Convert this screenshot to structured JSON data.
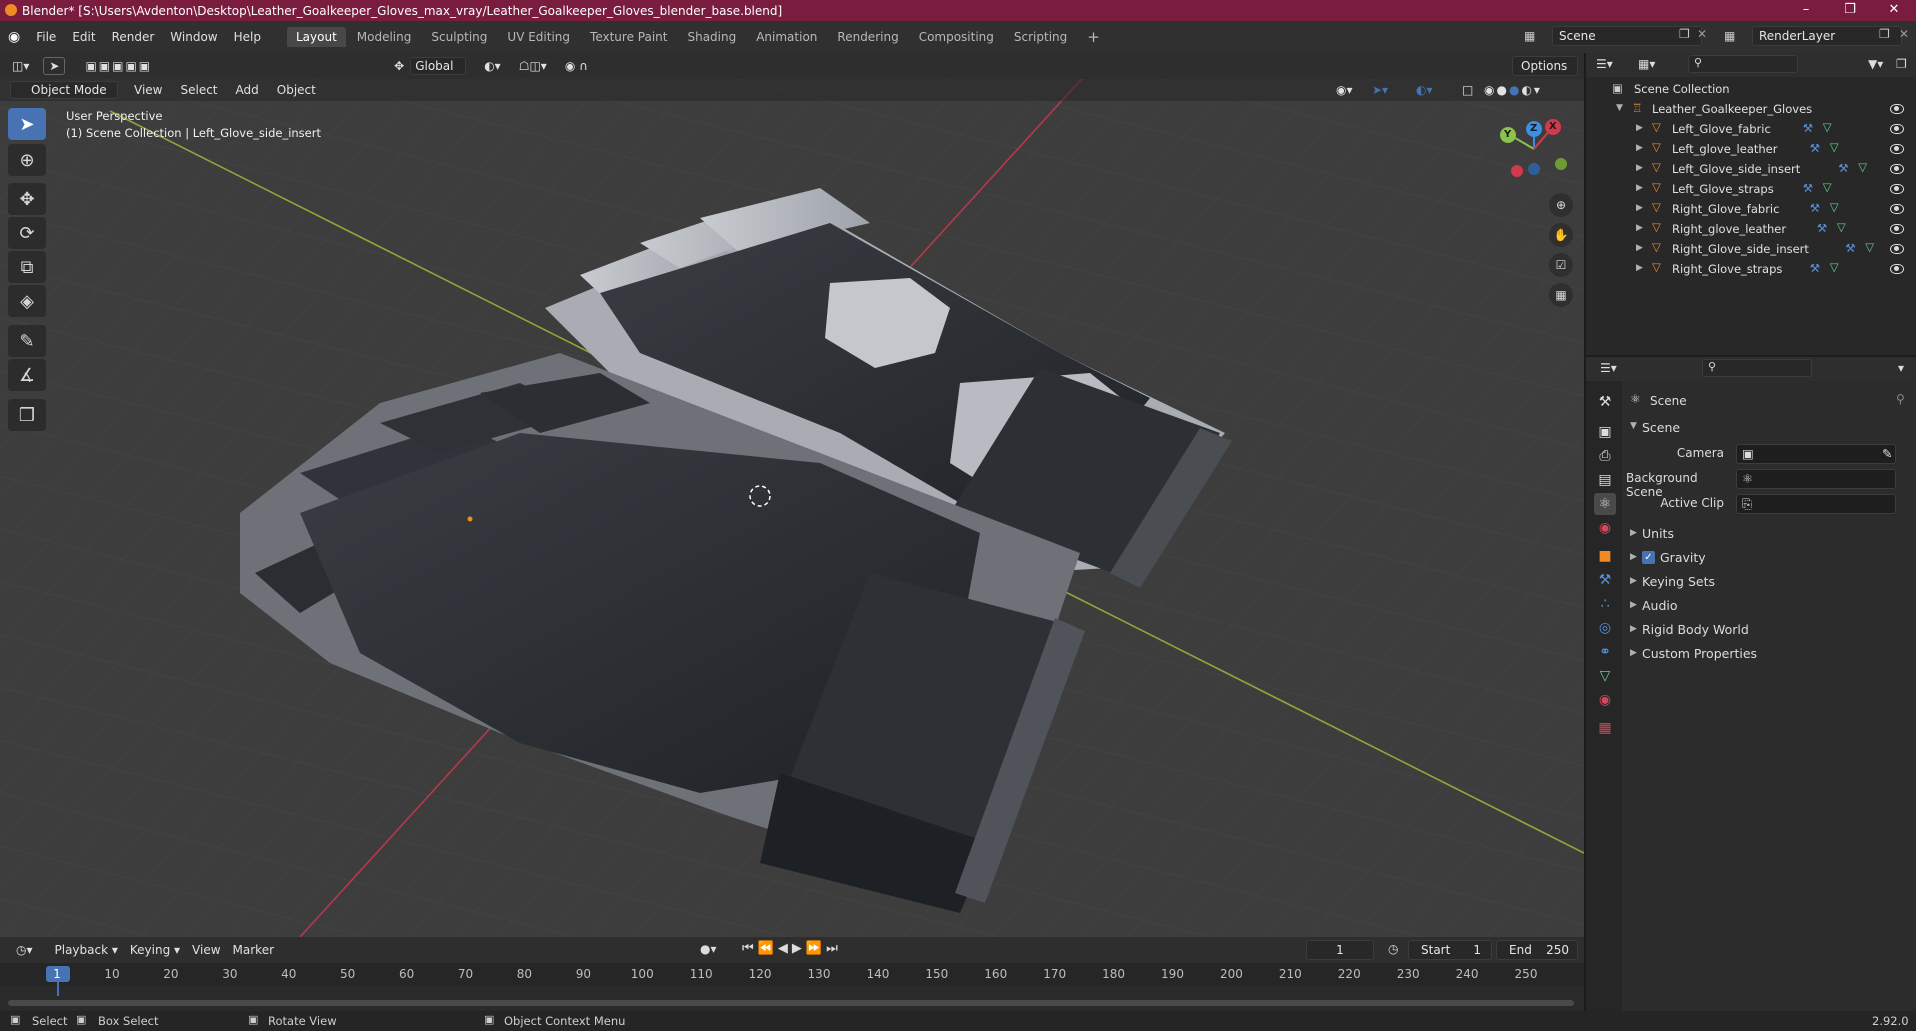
{
  "title": "Blender* [S:\\Users\\Avdenton\\Desktop\\Leather_Goalkeeper_Gloves_max_vray/Leather_Goalkeeper_Gloves_blender_base.blend]",
  "menu": [
    "File",
    "Edit",
    "Render",
    "Window",
    "Help"
  ],
  "workspaces": [
    "Layout",
    "Modeling",
    "Sculpting",
    "UV Editing",
    "Texture Paint",
    "Shading",
    "Animation",
    "Rendering",
    "Compositing",
    "Scripting"
  ],
  "active_workspace": "Layout",
  "scene_name": "Scene",
  "view_layer": "RenderLayer",
  "toolbar": {
    "orientation": "Global",
    "options": "Options"
  },
  "viewport": {
    "mode": "Object Mode",
    "menus": [
      "View",
      "Select",
      "Add",
      "Object"
    ],
    "overlay_title": "User Perspective",
    "overlay_sub": "(1) Scene Collection | Left_Glove_side_insert",
    "gizmo": {
      "x": "X",
      "y": "Y",
      "z": "Z"
    }
  },
  "outliner": {
    "root": "Scene Collection",
    "collection": "Leather_Goalkeeper_Gloves",
    "objects": [
      "Left_Glove_fabric",
      "Left_glove_leather",
      "Left_Glove_side_insert",
      "Left_Glove_straps",
      "Right_Glove_fabric",
      "Right_glove_leather",
      "Right_Glove_side_insert",
      "Right_Glove_straps"
    ]
  },
  "properties": {
    "breadcrumb": "Scene",
    "panel": "Scene",
    "fields": [
      {
        "label": "Camera"
      },
      {
        "label": "Background Scene"
      },
      {
        "label": "Active Clip"
      }
    ],
    "subpanels": [
      "Units",
      "Gravity",
      "Keying Sets",
      "Audio",
      "Rigid Body World",
      "Custom Properties"
    ],
    "gravity_checked": true
  },
  "timeline": {
    "menus": [
      "Playback",
      "Keying",
      "View",
      "Marker"
    ],
    "current_frame": "1",
    "start_label": "Start",
    "start": "1",
    "end_label": "End",
    "end": "250",
    "ruler": [
      "1",
      "10",
      "20",
      "30",
      "40",
      "50",
      "60",
      "70",
      "80",
      "90",
      "100",
      "110",
      "120",
      "130",
      "140",
      "150",
      "160",
      "170",
      "180",
      "190",
      "200",
      "210",
      "220",
      "230",
      "240",
      "250"
    ]
  },
  "status": {
    "select": "Select",
    "box_select": "Box Select",
    "rotate": "Rotate View",
    "context": "Object Context Menu",
    "version": "2.92.0"
  },
  "colors": {
    "accent": "#4772b3",
    "title_bar": "#7a1c3d",
    "x_axis": "#d13a4a",
    "y_axis": "#8bc34a",
    "z_axis": "#3d8fe3"
  }
}
